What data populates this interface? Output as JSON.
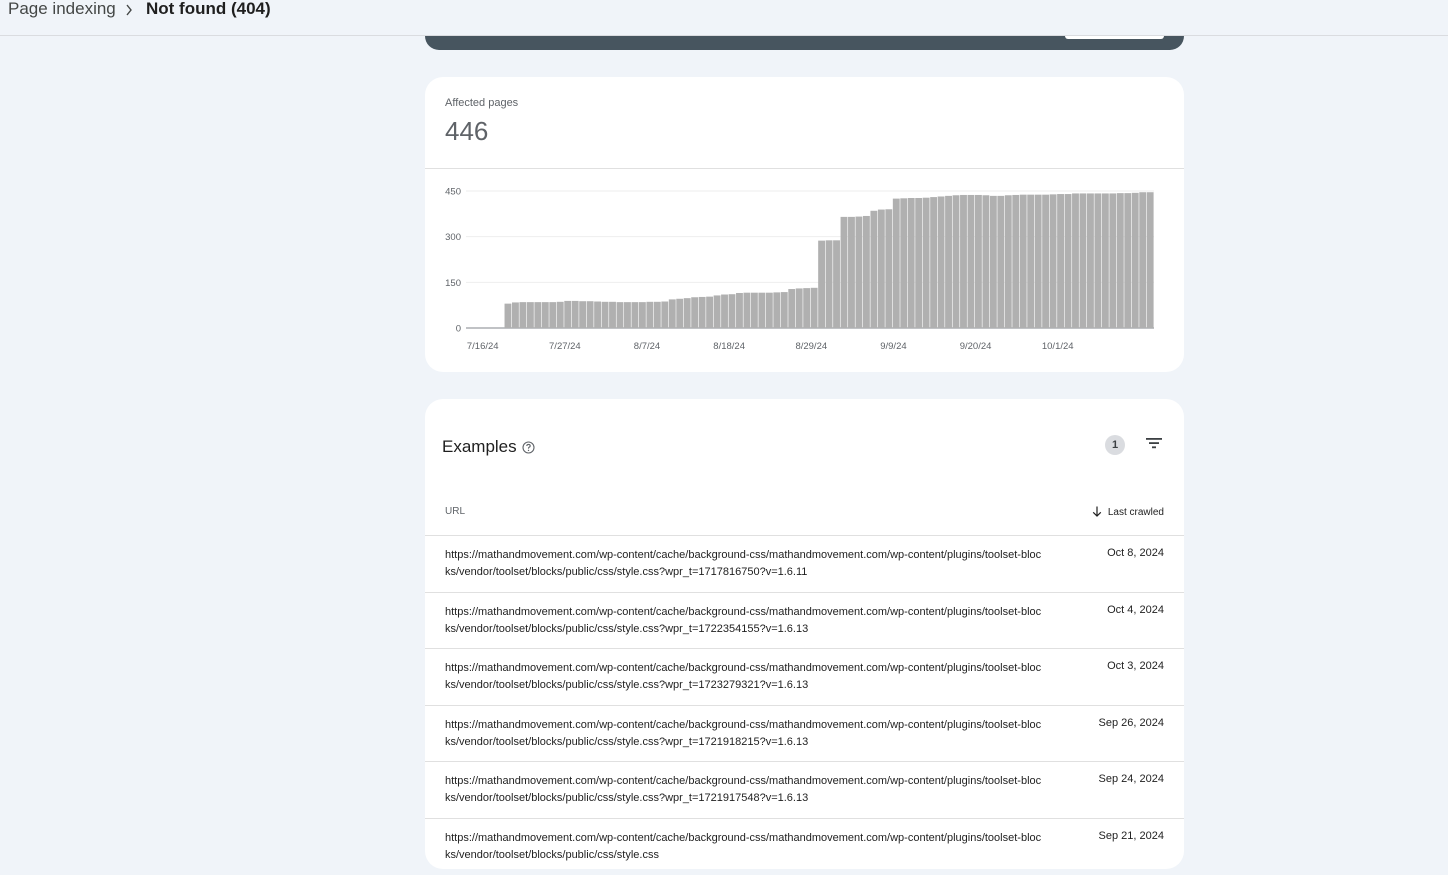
{
  "breadcrumb": {
    "root": "Page indexing",
    "current": "Not found (404)"
  },
  "summary": {
    "label": "Affected pages",
    "value": "446"
  },
  "chart_data": {
    "type": "bar",
    "title": "",
    "ylim": [
      0,
      450
    ],
    "y_ticks": [
      "0",
      "150",
      "300",
      "450"
    ],
    "x_tick_labels": [
      "7/16/24",
      "7/27/24",
      "8/7/24",
      "8/18/24",
      "8/29/24",
      "9/9/24",
      "9/20/24",
      "10/1/24"
    ],
    "x_start": "7/16/24",
    "values": [
      0,
      0,
      0,
      0,
      0,
      80,
      84,
      85,
      85,
      85,
      85,
      85,
      86,
      89,
      89,
      88,
      88,
      87,
      86,
      86,
      85,
      85,
      85,
      85,
      86,
      86,
      87,
      94,
      96,
      98,
      101,
      102,
      103,
      107,
      110,
      111,
      115,
      116,
      116,
      116,
      116,
      117,
      118,
      128,
      130,
      131,
      132,
      287,
      288,
      288,
      365,
      365,
      366,
      368,
      385,
      389,
      390,
      425,
      426,
      427,
      427,
      428,
      430,
      432,
      434,
      436,
      437,
      437,
      437,
      436,
      434,
      434,
      436,
      437,
      438,
      438,
      438,
      438,
      439,
      440,
      440,
      442,
      442,
      442,
      442,
      442,
      442,
      443,
      443,
      444,
      446,
      446
    ]
  },
  "examples": {
    "title": "Examples",
    "filter_count": "1",
    "columns": {
      "url": "URL",
      "last_crawled": "Last crawled"
    },
    "rows": [
      {
        "url": "https://mathandmovement.com/wp-content/cache/background-css/mathandmovement.com/wp-content/plugins/toolset-blocks/vendor/toolset/blocks/public/css/style.css?wpr_t=1717816750?v=1.6.11",
        "date": "Oct 8, 2024"
      },
      {
        "url": "https://mathandmovement.com/wp-content/cache/background-css/mathandmovement.com/wp-content/plugins/toolset-blocks/vendor/toolset/blocks/public/css/style.css?wpr_t=1722354155?v=1.6.13",
        "date": "Oct 4, 2024"
      },
      {
        "url": "https://mathandmovement.com/wp-content/cache/background-css/mathandmovement.com/wp-content/plugins/toolset-blocks/vendor/toolset/blocks/public/css/style.css?wpr_t=1723279321?v=1.6.13",
        "date": "Oct 3, 2024"
      },
      {
        "url": "https://mathandmovement.com/wp-content/cache/background-css/mathandmovement.com/wp-content/plugins/toolset-blocks/vendor/toolset/blocks/public/css/style.css?wpr_t=1721918215?v=1.6.13",
        "date": "Sep 26, 2024"
      },
      {
        "url": "https://mathandmovement.com/wp-content/cache/background-css/mathandmovement.com/wp-content/plugins/toolset-blocks/vendor/toolset/blocks/public/css/style.css?wpr_t=1721917548?v=1.6.13",
        "date": "Sep 24, 2024"
      },
      {
        "url": "https://mathandmovement.com/wp-content/cache/background-css/mathandmovement.com/wp-content/plugins/toolset-blocks/vendor/toolset/blocks/public/css/style.css",
        "date": "Sep 21, 2024"
      }
    ]
  }
}
